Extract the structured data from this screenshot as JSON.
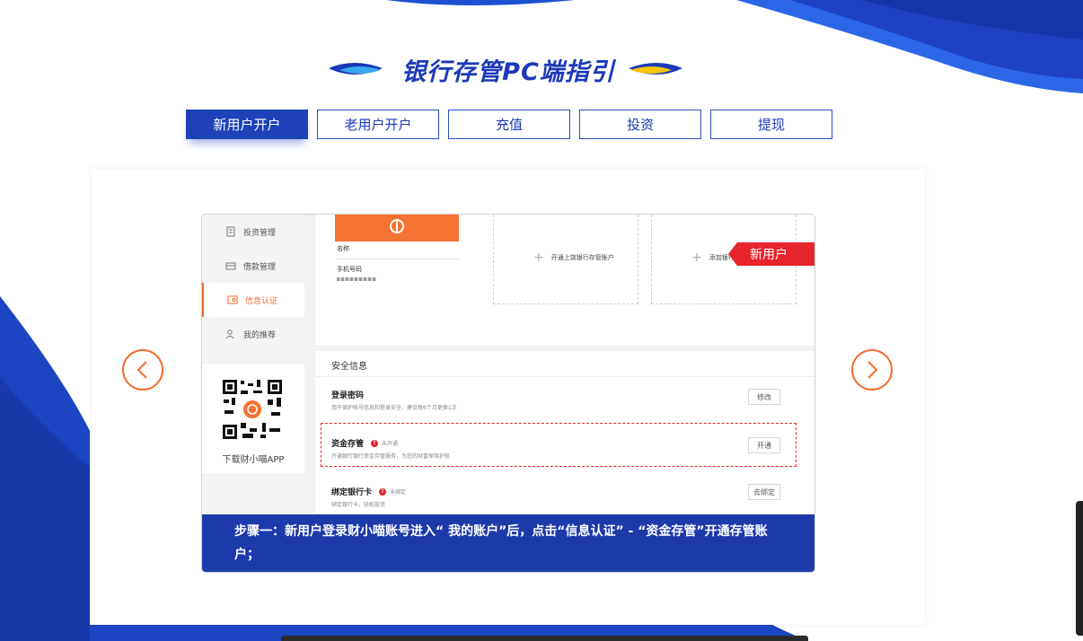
{
  "page": {
    "title": "银行存管PC端指引"
  },
  "tabs": [
    {
      "label": "新用户开户",
      "active": true
    },
    {
      "label": "老用户开户",
      "active": false
    },
    {
      "label": "充值",
      "active": false
    },
    {
      "label": "投资",
      "active": false
    },
    {
      "label": "提现",
      "active": false
    }
  ],
  "screenshot": {
    "sidebar": {
      "items": [
        {
          "label": "投资管理",
          "icon": "document-icon",
          "active": false
        },
        {
          "label": "借款管理",
          "icon": "wallet-icon",
          "active": false
        },
        {
          "label": "信息认证",
          "icon": "id-card-icon",
          "active": true
        },
        {
          "label": "我的推荐",
          "icon": "users-icon",
          "active": false
        }
      ],
      "qr_label": "下载财小喵APP"
    },
    "account_card": {
      "name_label": "名称",
      "phone_label": "手机号码"
    },
    "open_account_label": "开通上饶银行存管账户",
    "add_card_label": "添加银行卡",
    "ribbon": "新用户",
    "security": {
      "title": "安全信息",
      "rows": [
        {
          "title": "登录密码",
          "status": "",
          "desc": "用于保护帐号信息和登录安全，建议每6个月更换1次",
          "button": "修改"
        },
        {
          "title": "资金存管",
          "status": "未开通",
          "desc": "开通银行银行资金存管服务，为您的财富保驾护航",
          "button": "开通"
        },
        {
          "title": "绑定银行卡",
          "status": "未绑定",
          "desc": "绑定银行卡，轻松投资",
          "button": "去绑定"
        }
      ]
    },
    "caption": "步骤一：新用户登录财小喵账号进入“ 我的账户”后，点击“信息认证” - “资金存管”开通存管账户；"
  },
  "colors": {
    "brand_blue": "#1e43b8",
    "accent_orange": "#f26d2d",
    "alert_red": "#e8242b"
  }
}
